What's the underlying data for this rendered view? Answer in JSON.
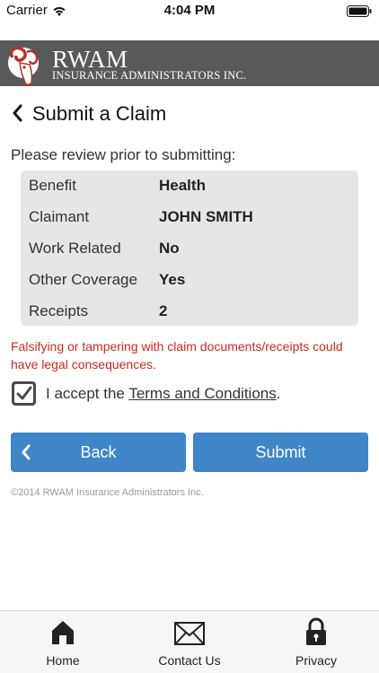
{
  "status_bar": {
    "carrier": "Carrier",
    "time": "4:04 PM",
    "icons": [
      "wifi-icon",
      "battery-icon"
    ]
  },
  "brand": {
    "name": "RWAM",
    "subtitle": "INSURANCE ADMINISTRATORS INC.",
    "logo": "ram-logo"
  },
  "page": {
    "title": "Submit a Claim",
    "review_prompt": "Please review prior to submitting:"
  },
  "summary": [
    {
      "label": "Benefit",
      "value": "Health"
    },
    {
      "label": "Claimant",
      "value": "JOHN SMITH"
    },
    {
      "label": "Work Related",
      "value": "No"
    },
    {
      "label": "Other Coverage",
      "value": "Yes"
    },
    {
      "label": "Receipts",
      "value": "2"
    }
  ],
  "warning": "Falsifying or tampering with claim documents/receipts could have legal consequences.",
  "terms": {
    "prefix": "I accept the ",
    "link": "Terms and Conditions",
    "suffix": ".",
    "checked": true
  },
  "buttons": {
    "back": "Back",
    "submit": "Submit"
  },
  "copyright": "©2014 RWAM Insurance Administrators Inc.",
  "tabs": [
    {
      "label": "Home",
      "icon": "home-icon"
    },
    {
      "label": "Contact Us",
      "icon": "envelope-icon"
    },
    {
      "label": "Privacy",
      "icon": "lock-icon"
    }
  ],
  "colors": {
    "header_bg": "#58595b",
    "button_blue": "#3e86c8",
    "warning_red": "#cc2a1e",
    "card_bg": "#e6e6e6"
  }
}
